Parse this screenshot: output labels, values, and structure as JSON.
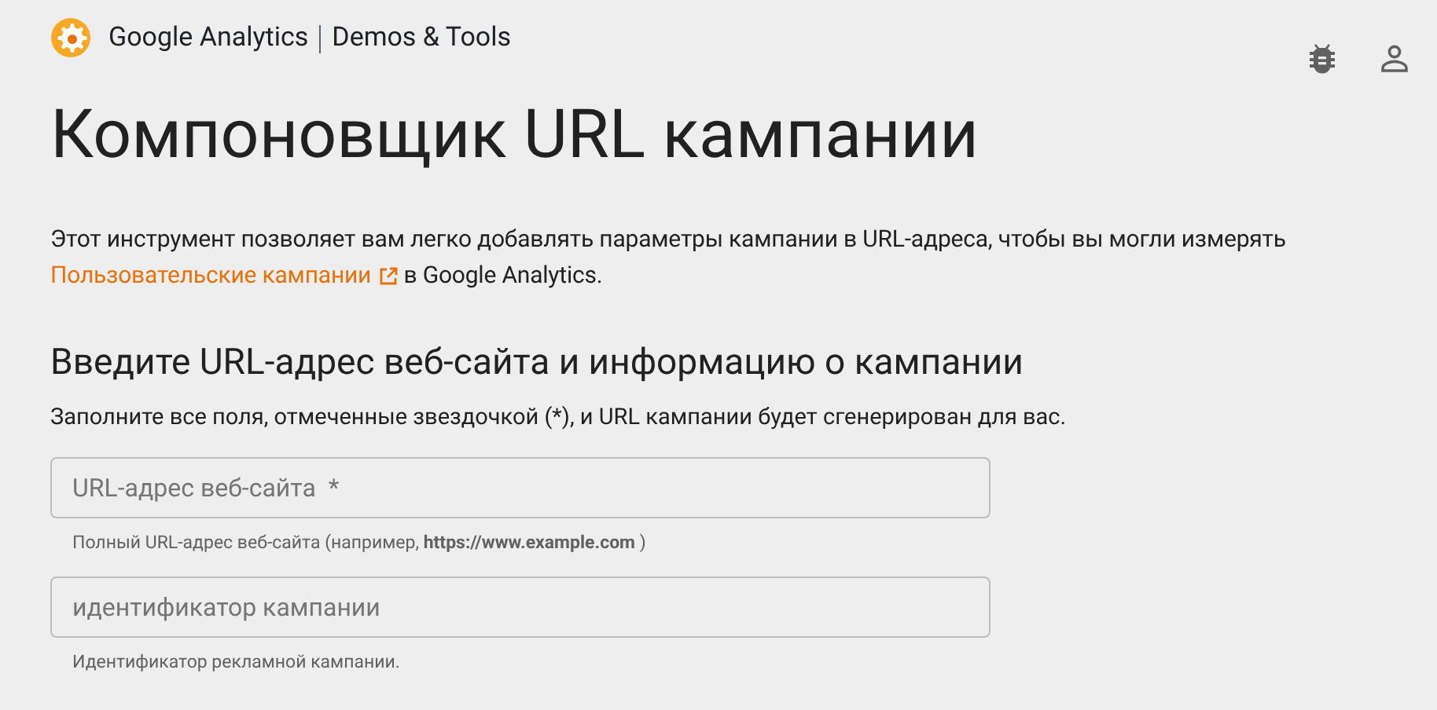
{
  "header": {
    "brand": "Google Analytics",
    "section": "Demos & Tools"
  },
  "title": "Компоновщик URL кампании",
  "intro": {
    "text": "Этот инструмент позволяет вам легко добавлять параметры кампании в URL-адреса, чтобы вы могли измерять",
    "link": "Пользовательские кампании",
    "after": "в Google Analytics."
  },
  "form": {
    "heading": "Введите URL-адрес веб-сайта и информацию о кампании",
    "note": "Заполните все поля, отмеченные звездочкой (*), и URL кампании будет сгенерирован для вас.",
    "fields": [
      {
        "placeholder": "URL-адрес веб-сайта  *",
        "helper": "Полный URL-адрес веб-сайта (например, **https://www.example.com** )"
      },
      {
        "placeholder": "идентификатор кампании",
        "helper": "Идентификатор рекламной кампании."
      }
    ]
  }
}
